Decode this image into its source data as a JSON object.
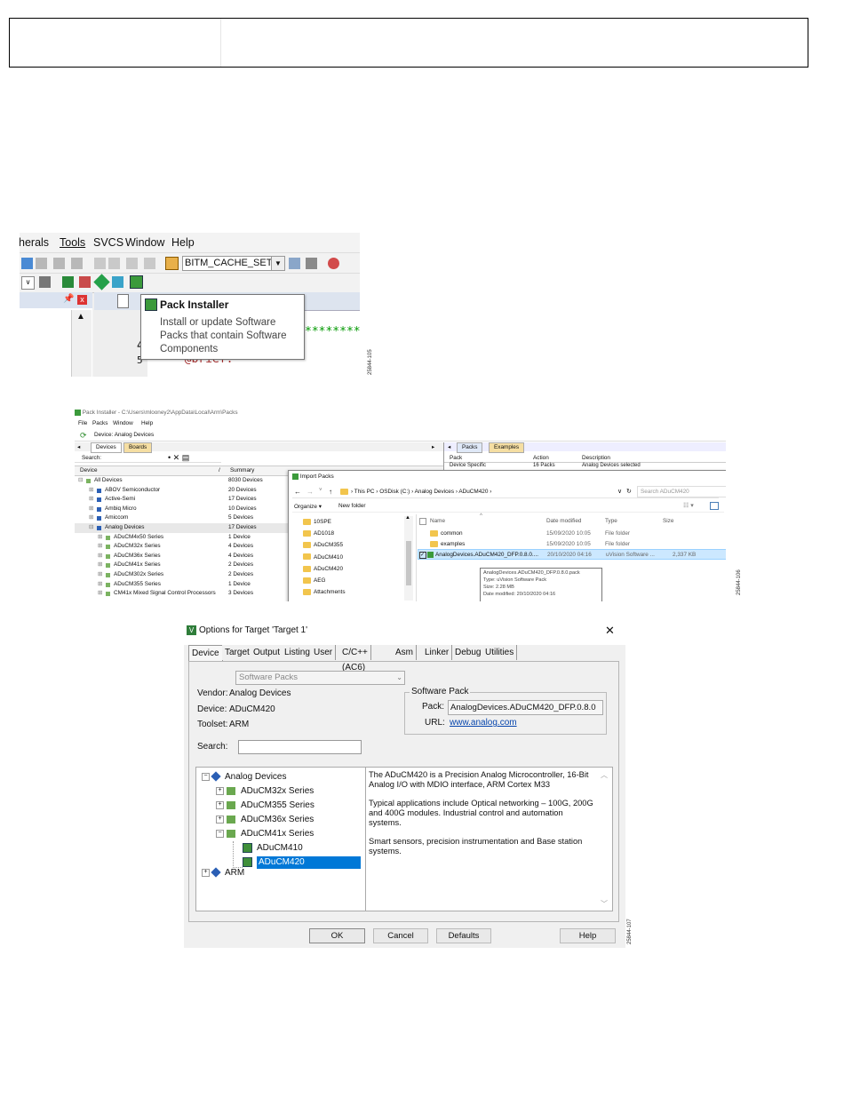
{
  "figure1": {
    "menu": [
      "herals",
      "Tools",
      "SVCS",
      "Window",
      "Help"
    ],
    "target_combo": "BITM_CACHE_SETUF",
    "code_line_number": "4",
    "code_line_number_2": "5",
    "code_stars": "*********",
    "code_brief": "* @brief:",
    "tooltip": {
      "title": "Pack Installer",
      "body": "Install or update Software Packs that contain Software Components"
    },
    "fig_id": "25844-105"
  },
  "figure2": {
    "title": "Pack Installer - C:\\Users\\mlooney2\\AppData\\Local\\Arm\\Packs",
    "menu": [
      "File",
      "Packs",
      "Window",
      "Help"
    ],
    "device_label": "Device:  Analog Devices",
    "tabs": [
      "Devices",
      "Boards"
    ],
    "search_label": "Search:",
    "columns": [
      "Device",
      "Summary"
    ],
    "rows": [
      {
        "name": "All Devices",
        "summary": "8030 Devices"
      },
      {
        "name": "ABOV Semiconductor",
        "summary": "20 Devices"
      },
      {
        "name": "Active-Semi",
        "summary": "17 Devices"
      },
      {
        "name": "Ambiq Micro",
        "summary": "10 Devices"
      },
      {
        "name": "Amiccom",
        "summary": "5 Devices"
      },
      {
        "name": "Analog Devices",
        "summary": "17 Devices"
      },
      {
        "name": "ADuCM4x50 Series",
        "summary": "1 Device"
      },
      {
        "name": "ADuCM32x Series",
        "summary": "4 Devices"
      },
      {
        "name": "ADuCM36x Series",
        "summary": "4 Devices"
      },
      {
        "name": "ADuCM41x Series",
        "summary": "2 Devices"
      },
      {
        "name": "ADuCM302x Series",
        "summary": "2 Devices"
      },
      {
        "name": "ADuCM355 Series",
        "summary": "1 Device"
      },
      {
        "name": "CM41x Mixed Signal Control Processors",
        "summary": "3 Devices"
      }
    ],
    "right_tabs": [
      "Packs",
      "Examples"
    ],
    "right_columns": [
      "Pack",
      "Action",
      "Description"
    ],
    "right_row": {
      "pack": "Device Specific",
      "action": "16 Packs",
      "desc": "Analog Devices selected"
    },
    "import": {
      "title": "Import Packs",
      "path": [
        "This PC",
        "OSDisk (C:)",
        "Analog Devices",
        "ADuCM420"
      ],
      "search_placeholder": "Search ADuCM420",
      "organize": "Organize ▾",
      "new_folder": "New folder",
      "nav_items": [
        "10SPE",
        "AD1018",
        "ADuCM355",
        "ADuCM410",
        "ADuCM420",
        "AEG",
        "Attachments"
      ],
      "list_headers": [
        "Name",
        "Date modified",
        "Type",
        "Size"
      ],
      "files": [
        {
          "name": "common",
          "date": "15/09/2020 10:05",
          "type": "File folder",
          "size": ""
        },
        {
          "name": "examples",
          "date": "15/09/2020 10:05",
          "type": "File folder",
          "size": ""
        },
        {
          "name": "AnalogDevices.ADuCM420_DFP.0.8.0....",
          "date": "20/10/2020 04:16",
          "type": "uVision Software ...",
          "size": "2,337 KB"
        }
      ],
      "tooltip": [
        "AnalogDevices.ADuCM420_DFP.0.8.0.pack",
        "Type: uVision Software Pack",
        "Size: 2.28 MB",
        "Date modified: 20/10/2020 04:16"
      ]
    },
    "fig_id": "25844-106"
  },
  "figure3": {
    "title": "Options for Target 'Target 1'",
    "tabs": [
      "Device",
      "Target",
      "Output",
      "Listing",
      "User",
      "C/C++ (AC6)",
      "Asm",
      "Linker",
      "Debug",
      "Utilities"
    ],
    "combo": "Software Packs",
    "vendor_label": "Vendor:",
    "vendor": "Analog Devices",
    "device_label": "Device:",
    "device": "ADuCM420",
    "toolset_label": "Toolset:",
    "toolset": "ARM",
    "search_label": "Search:",
    "software_pack": "Software Pack",
    "pack_label": "Pack:",
    "pack": "AnalogDevices.ADuCM420_DFP.0.8.0",
    "url_label": "URL:",
    "url": "www.analog.com",
    "tree": [
      "Analog Devices",
      "ADuCM32x Series",
      "ADuCM355 Series",
      "ADuCM36x Series",
      "ADuCM41x Series",
      "ADuCM410",
      "ADuCM420",
      "ARM"
    ],
    "description": [
      "The ADuCM420 is a Precision Analog Microcontroller, 16-Bit Analog I/O with MDIO interface, ARM Cortex M33",
      "Typical applications include Optical networking – 100G, 200G and 400G modules. Industrial control and automation systems.",
      "Smart sensors, precision instrumentation and Base station systems."
    ],
    "buttons": [
      "OK",
      "Cancel",
      "Defaults",
      "Help"
    ],
    "fig_id": "25844-107"
  }
}
